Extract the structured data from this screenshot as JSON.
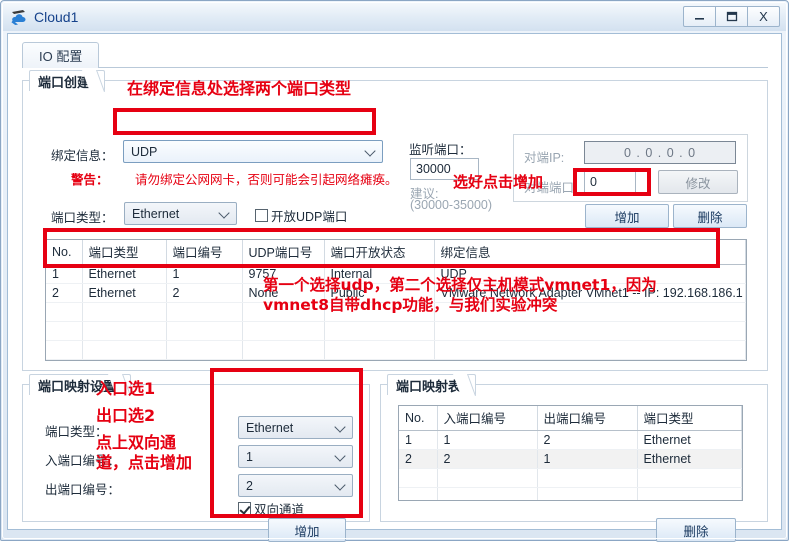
{
  "window": {
    "title": "Cloud1",
    "icon": "cloud-icon",
    "buttons": {
      "minimize": "—",
      "maximize": "❑",
      "close": "X"
    }
  },
  "tabs": [
    {
      "label": "IO 配置",
      "active": true
    }
  ],
  "port_create": {
    "title": "端口创建",
    "bind_info_label": "绑定信息：",
    "bind_info_value": "UDP",
    "warning_label": "警告：",
    "warning_text": "请勿绑定公网网卡，否则可能会引起网络瘫痪。",
    "port_type_label": "端口类型：",
    "port_type_value": "Ethernet",
    "open_udp_label": "开放UDP端口",
    "open_udp_checked": false,
    "listen_port_label": "监听端口：",
    "listen_port_value": "30000",
    "suggest_label": "建议:",
    "suggest_range": "(30000-35000)",
    "peer_ip_label": "对端IP:",
    "peer_ip_value": "0  .  0  .  0  .  0",
    "peer_port_label": "对端端口:",
    "peer_port_value": "0",
    "modify_button": "修改",
    "add_button": "增加",
    "delete_button": "删除"
  },
  "port_table": {
    "columns": [
      "No.",
      "端口类型",
      "端口编号",
      "UDP端口号",
      "端口开放状态",
      "绑定信息"
    ],
    "rows": [
      [
        "1",
        "Ethernet",
        "1",
        "9757",
        "Internal",
        "UDP"
      ],
      [
        "2",
        "Ethernet",
        "2",
        "None",
        "Public",
        "VMware Network Adapter VMnet1 -- IP: 192.168.186.1"
      ],
      [
        "",
        "",
        "",
        "",
        "",
        ""
      ],
      [
        "",
        "",
        "",
        "",
        "",
        ""
      ],
      [
        "",
        "",
        "",
        "",
        "",
        ""
      ],
      [
        "",
        "",
        "",
        "",
        "",
        ""
      ]
    ]
  },
  "port_map_settings": {
    "title": "端口映射设置",
    "port_type_label": "端口类型：",
    "port_type_value": "Ethernet",
    "in_port_label": "入端口编号：",
    "in_port_value": "1",
    "out_port_label": "出端口编号：",
    "out_port_value": "2",
    "bidir_label": "双向通道",
    "bidir_checked": true,
    "add_button": "增加"
  },
  "port_map_table": {
    "title": "端口映射表",
    "columns": [
      "No.",
      "入端口编号",
      "出端口编号",
      "端口类型"
    ],
    "rows": [
      [
        "1",
        "1",
        "2",
        "Ethernet"
      ],
      [
        "2",
        "2",
        "1",
        "Ethernet"
      ],
      [
        "",
        "",
        "",
        ""
      ],
      [
        "",
        "",
        "",
        ""
      ],
      [
        "",
        "",
        "",
        ""
      ]
    ],
    "delete_button": "删除"
  },
  "annotations": {
    "color": "#e60012",
    "note_bind_type": "在绑定信息处选择两个端口类型",
    "note_click_add": "选好点击增加",
    "note_table_line1": "第一个选择udp，第二个选择仅主机模式vmnet1，因为",
    "note_table_line2": "vmnet8自带dhcp功能，与我们实验冲突",
    "note_in_select": "入口选1",
    "note_out_select": "出口选2",
    "note_bidir_line1": "点上双向通",
    "note_bidir_line2": "道，点击增加"
  }
}
